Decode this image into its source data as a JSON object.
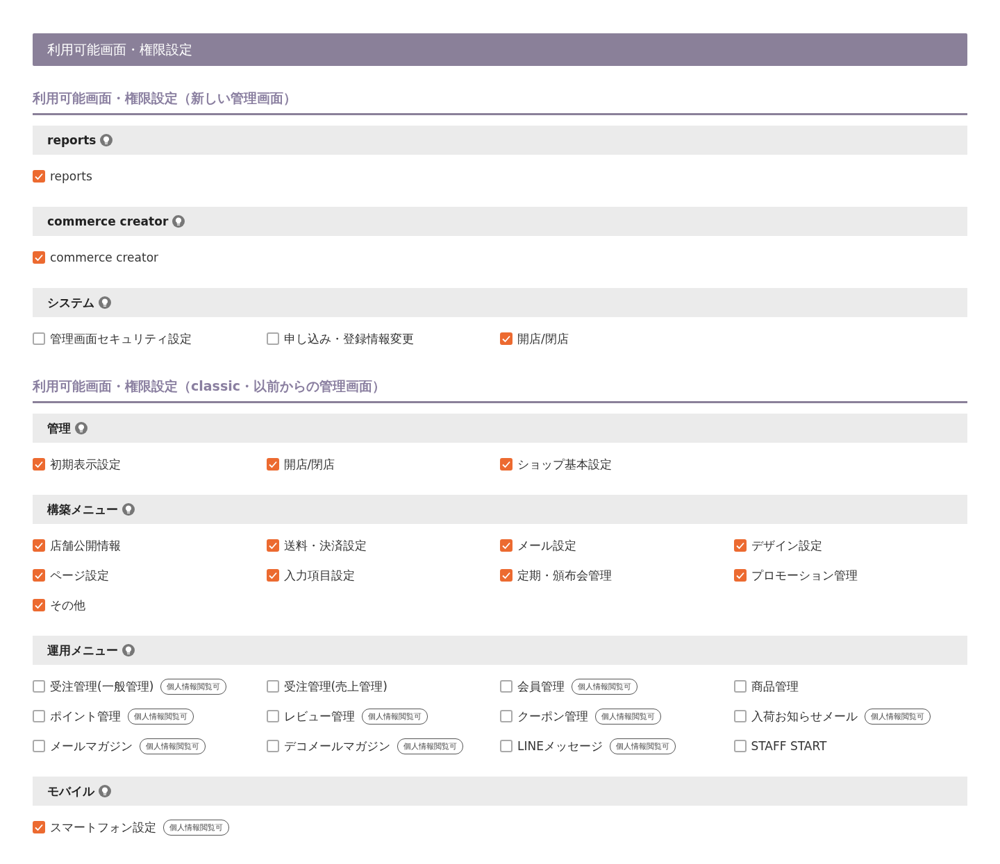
{
  "header": {
    "title": "利用可能画面・権限設定"
  },
  "sections": [
    {
      "title": "利用可能画面・権限設定（新しい管理画面）",
      "groups": [
        {
          "title": "reports",
          "items": [
            {
              "label": "reports",
              "checked": true
            }
          ]
        },
        {
          "title": "commerce creator",
          "items": [
            {
              "label": "commerce creator",
              "checked": true
            }
          ]
        },
        {
          "title": "システム",
          "items": [
            {
              "label": "管理画面セキュリティ設定",
              "checked": false
            },
            {
              "label": "申し込み・登録情報変更",
              "checked": false
            },
            {
              "label": "開店/閉店",
              "checked": true
            }
          ]
        }
      ]
    },
    {
      "title": "利用可能画面・権限設定（classic・以前からの管理画面）",
      "groups": [
        {
          "title": "管理",
          "items": [
            {
              "label": "初期表示設定",
              "checked": true
            },
            {
              "label": "開店/閉店",
              "checked": true
            },
            {
              "label": "ショップ基本設定",
              "checked": true
            }
          ]
        },
        {
          "title": "構築メニュー",
          "items": [
            {
              "label": "店舗公開情報",
              "checked": true
            },
            {
              "label": "送料・決済設定",
              "checked": true
            },
            {
              "label": "メール設定",
              "checked": true
            },
            {
              "label": "デザイン設定",
              "checked": true
            },
            {
              "label": "ページ設定",
              "checked": true
            },
            {
              "label": "入力項目設定",
              "checked": true
            },
            {
              "label": "定期・頒布会管理",
              "checked": true
            },
            {
              "label": "プロモーション管理",
              "checked": true
            },
            {
              "label": "その他",
              "checked": true
            }
          ]
        },
        {
          "title": "運用メニュー",
          "items": [
            {
              "label": "受注管理(一般管理)",
              "checked": false,
              "badge": "個人情報閲覧可"
            },
            {
              "label": "受注管理(売上管理)",
              "checked": false
            },
            {
              "label": "会員管理",
              "checked": false,
              "badge": "個人情報閲覧可"
            },
            {
              "label": "商品管理",
              "checked": false
            },
            {
              "label": "ポイント管理",
              "checked": false,
              "badge": "個人情報閲覧可"
            },
            {
              "label": "レビュー管理",
              "checked": false,
              "badge": "個人情報閲覧可"
            },
            {
              "label": "クーポン管理",
              "checked": false,
              "badge": "個人情報閲覧可"
            },
            {
              "label": "入荷お知らせメール",
              "checked": false,
              "badge": "個人情報閲覧可"
            },
            {
              "label": "メールマガジン",
              "checked": false,
              "badge": "個人情報閲覧可"
            },
            {
              "label": "デコメールマガジン",
              "checked": false,
              "badge": "個人情報閲覧可"
            },
            {
              "label": "LINEメッセージ",
              "checked": false,
              "badge": "個人情報閲覧可"
            },
            {
              "label": "STAFF START",
              "checked": false
            }
          ]
        },
        {
          "title": "モバイル",
          "items": [
            {
              "label": "スマートフォン設定",
              "checked": true,
              "badge": "個人情報閲覧可"
            }
          ]
        }
      ]
    }
  ]
}
